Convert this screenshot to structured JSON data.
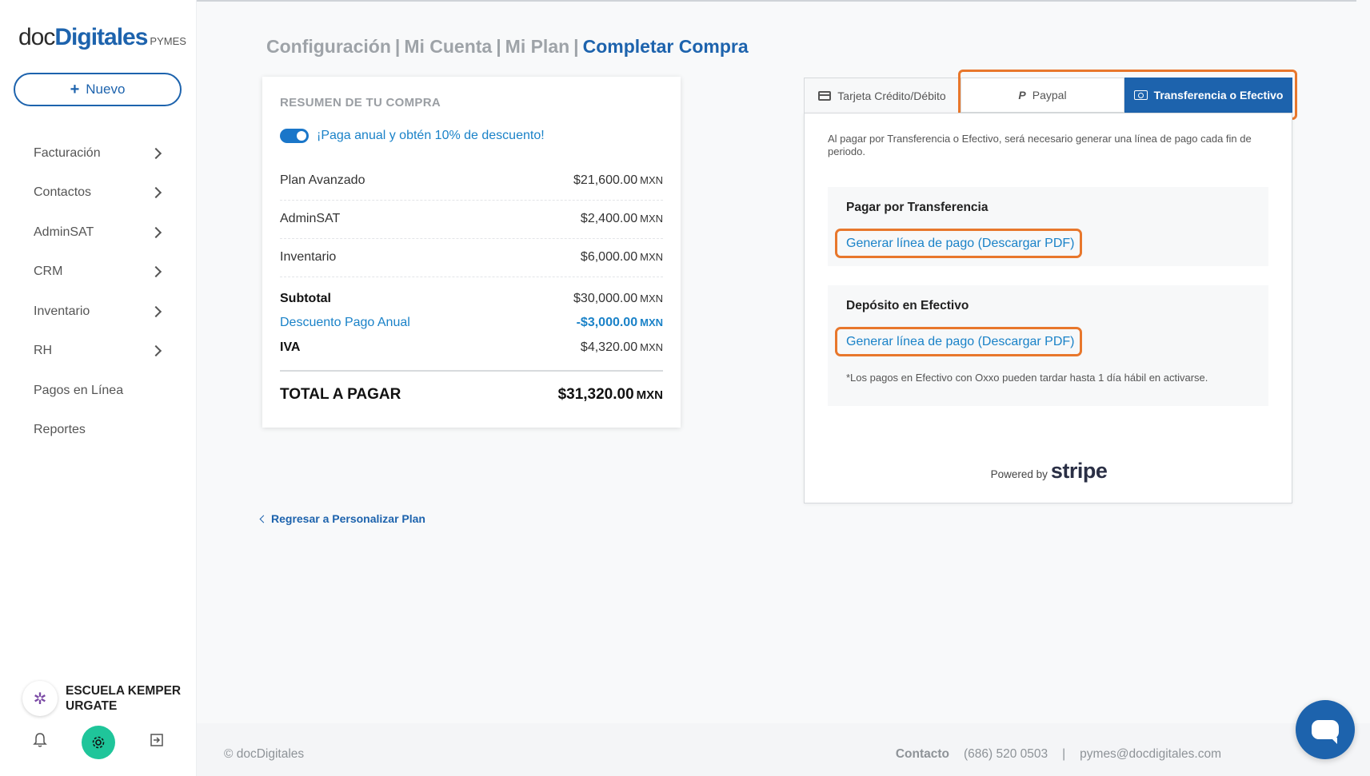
{
  "brand": {
    "doc": "doc",
    "digitales": "Digitales",
    "pymes": "PYMES"
  },
  "sidebar": {
    "new_button": "Nuevo",
    "items": [
      {
        "label": "Facturación",
        "has_chevron": true
      },
      {
        "label": "Contactos",
        "has_chevron": true
      },
      {
        "label": "AdminSAT",
        "has_chevron": true
      },
      {
        "label": "CRM",
        "has_chevron": true
      },
      {
        "label": "Inventario",
        "has_chevron": true
      },
      {
        "label": "RH",
        "has_chevron": true
      },
      {
        "label": "Pagos en Línea",
        "has_chevron": false
      },
      {
        "label": "Reportes",
        "has_chevron": false
      }
    ],
    "user_name": "ESCUELA KEMPER URGATE",
    "icons": [
      "bell-icon",
      "gear-icon",
      "logout-icon"
    ]
  },
  "breadcrumb": [
    "Configuración",
    "Mi Cuenta",
    "Mi Plan",
    "Completar Compra"
  ],
  "summary": {
    "title": "RESUMEN DE TU COMPRA",
    "annual_toggle_label": "¡Paga anual y obtén 10% de descuento!",
    "annual_toggle_on": true,
    "currency": "MXN",
    "items": [
      {
        "label": "Plan Avanzado",
        "amount": "$21,600.00"
      },
      {
        "label": "AdminSAT",
        "amount": "$2,400.00"
      },
      {
        "label": "Inventario",
        "amount": "$6,000.00"
      }
    ],
    "subtotal": {
      "label": "Subtotal",
      "amount": "$30,000.00"
    },
    "discount": {
      "label": "Descuento Pago Anual",
      "amount": "-$3,000.00"
    },
    "iva": {
      "label": "IVA",
      "amount": "$4,320.00"
    },
    "total": {
      "label": "TOTAL A PAGAR",
      "amount": "$31,320.00"
    }
  },
  "back_link": "Regresar a Personalizar Plan",
  "payment": {
    "tabs": [
      {
        "label": "Tarjeta Crédito/Débito",
        "icon": "credit-card-icon"
      },
      {
        "label": "Paypal",
        "icon": "paypal-icon"
      },
      {
        "label": "Transferencia o Efectivo",
        "icon": "cash-icon",
        "active": true
      }
    ],
    "intro": "Al pagar por Transferencia o Efectivo, será necesario generar una línea de pago cada fin de periodo.",
    "transfer": {
      "title": "Pagar por Transferencia",
      "link": "Generar línea de pago (Descargar PDF)"
    },
    "cash": {
      "title": "Depósito en Efectivo",
      "link": "Generar línea de pago (Descargar PDF)",
      "note": "*Los pagos en Efectivo con Oxxo pueden tardar hasta 1 día hábil en activarse."
    },
    "powered_by": "Powered by",
    "stripe": "stripe"
  },
  "footer": {
    "copyright": "© docDigitales",
    "contact_label": "Contacto",
    "phone": "(686) 520 0503",
    "divider": "|",
    "email": "pymes@docdigitales.com"
  },
  "colors": {
    "brand_blue": "#1d63ad",
    "link_blue": "#1a82c8",
    "highlight_orange": "#e8772c",
    "settings_green": "#1fc59a"
  }
}
